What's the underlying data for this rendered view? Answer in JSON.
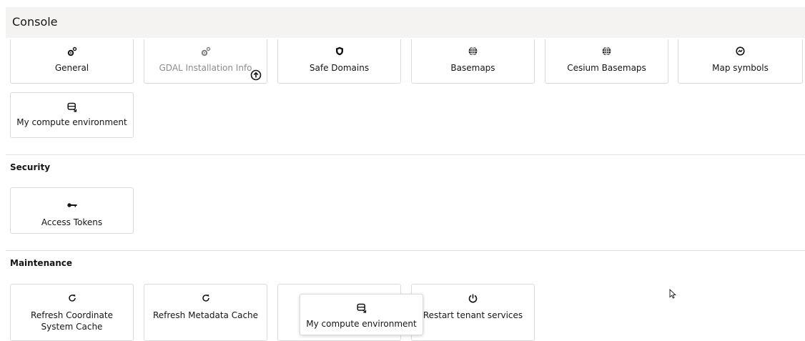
{
  "header": {
    "title": "Console"
  },
  "general_tiles": [
    {
      "label": "General",
      "icon": "gears-icon"
    },
    {
      "label": "GDAL Installation Info",
      "icon": "gears-icon",
      "disabled": true,
      "badge": "upload-icon"
    },
    {
      "label": "Safe Domains",
      "icon": "shield-icon"
    },
    {
      "label": "Basemaps",
      "icon": "globe-icon"
    },
    {
      "label": "Cesium Basemaps",
      "icon": "globe-icon"
    },
    {
      "label": "Map symbols",
      "icon": "map-symbol-icon"
    },
    {
      "label": "My compute environment",
      "icon": "compute-environment-icon"
    }
  ],
  "security": {
    "title": "Security",
    "tiles": [
      {
        "label": "Access Tokens",
        "icon": "key-icon"
      }
    ]
  },
  "maintenance": {
    "title": "Maintenance",
    "tiles": [
      {
        "label": "Refresh Coordinate System Cache",
        "icon": "refresh-icon"
      },
      {
        "label": "Refresh Metadata Cache",
        "icon": "refresh-icon"
      },
      {
        "label": "",
        "icon": ""
      },
      {
        "label": "Restart tenant services",
        "icon": "power-icon"
      }
    ],
    "dragging_tile": {
      "label": "My compute environment",
      "icon": "compute-environment-icon"
    }
  }
}
